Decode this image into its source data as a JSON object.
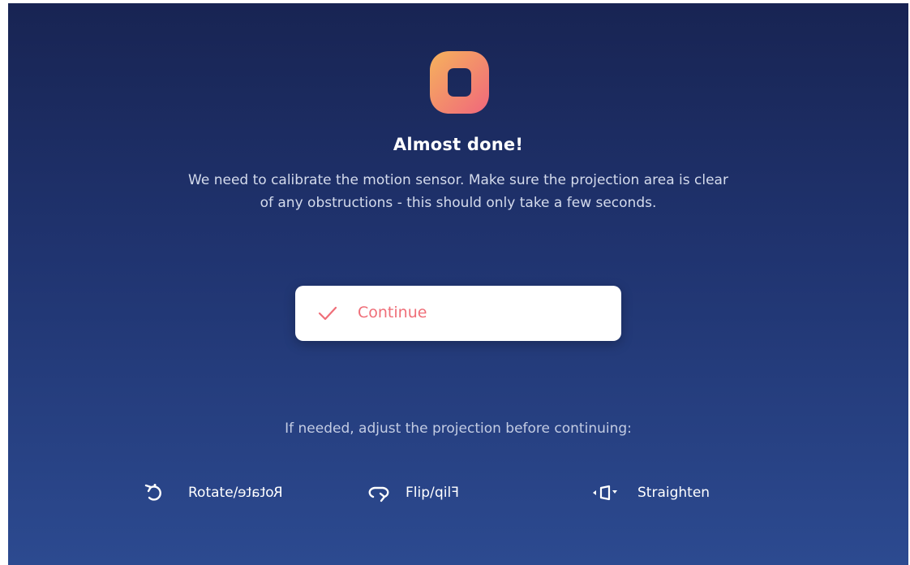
{
  "setup": {
    "logo_icon": "rounded-o-logo",
    "title": "Almost done!",
    "description_line1": "We need to calibrate the motion sensor. Make sure the projection area is clear",
    "description_line2": "of any obstructions - this should only take a few seconds.",
    "continue_label": "Continue",
    "continue_icon": "check-icon",
    "hint": "If needed, adjust the projection before continuing:"
  },
  "actions": [
    {
      "icon": "rotate-icon",
      "label": "Rotate",
      "separator": "/",
      "mirrored_label": "Rotate"
    },
    {
      "icon": "flip-icon",
      "label": "Flip",
      "separator": "/",
      "mirrored_label": "Flip"
    },
    {
      "icon": "straighten-icon",
      "label": "Straighten"
    }
  ],
  "colors": {
    "accent": "#ef6e78",
    "background_top": "#182453",
    "background_bottom": "#2c4a90",
    "logo_gradient_start": "#f6b25c",
    "logo_gradient_end": "#f0677c"
  }
}
